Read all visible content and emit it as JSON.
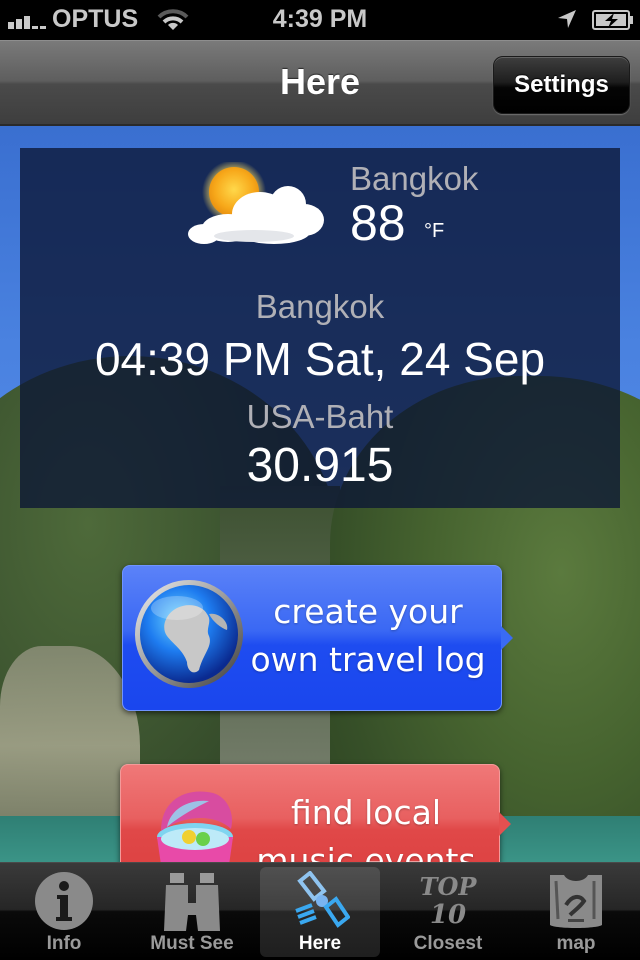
{
  "status_bar": {
    "carrier": "OPTUS",
    "time": "4:39 PM",
    "signal_bars": 3,
    "signal_bars_total": 5,
    "wifi_level": 2,
    "icons": [
      "signal-strength-icon",
      "wifi-icon",
      "location-arrow-icon",
      "battery-charging-icon"
    ]
  },
  "nav_bar": {
    "title": "Here",
    "settings_label": "Settings"
  },
  "info_card": {
    "weather": {
      "city": "Bangkok",
      "temperature": "88",
      "unit": "°F",
      "condition_icon": "partly-cloudy-icon"
    },
    "clock": {
      "city": "Bangkok",
      "datetime": "04:39 PM Sat, 24 Sep"
    },
    "currency": {
      "label": "USA-Baht",
      "value": "30.915"
    }
  },
  "promos": [
    {
      "line1": "create your",
      "line2": "own travel log",
      "icon": "globe-icon",
      "color": "#2a58f2"
    },
    {
      "line1": "find local",
      "line2": "music events",
      "icon": "cooler-icon",
      "color": "#e45050"
    }
  ],
  "tab_bar": {
    "active": "Here",
    "tabs": [
      {
        "label": "Info",
        "icon": "info-icon"
      },
      {
        "label": "Must See",
        "icon": "binoculars-icon"
      },
      {
        "label": "Here",
        "icon": "satellite-icon"
      },
      {
        "label": "Closest",
        "icon": "top-10-icon"
      },
      {
        "label": "map",
        "icon": "map-icon"
      }
    ]
  }
}
